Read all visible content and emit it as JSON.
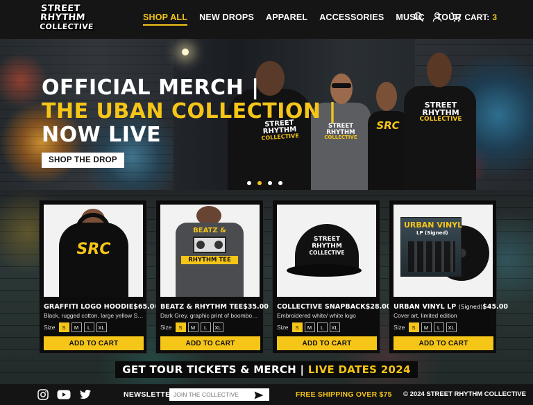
{
  "brand": {
    "logo_lines": [
      "STREET",
      "RHYTHM",
      "COLLECTIVE"
    ]
  },
  "nav": {
    "items": [
      {
        "label": "SHOP ALL",
        "active": true
      },
      {
        "label": "NEW DROPS"
      },
      {
        "label": "APPAREL"
      },
      {
        "label": "ACCESSORIES"
      },
      {
        "label": "MUSIC"
      },
      {
        "label": "TOUR"
      }
    ],
    "cart_label": "CART:",
    "cart_count": "3",
    "icons": [
      "search-icon",
      "user-icon",
      "cart-icon"
    ]
  },
  "hero": {
    "line1": "OFFICIAL MERCH |",
    "line2": "THE UBAN COLLECTION |",
    "line3": "NOW LIVE",
    "button": "SHOP THE DROP",
    "slide_count": 4,
    "active_slide": 2,
    "shirt_prints": [
      "STREET",
      "RHYTHM",
      "COLLECTIVE",
      "SRC"
    ]
  },
  "products": [
    {
      "name": "GRAFFITI LOGO HOODIE",
      "name_suffix": "",
      "price": "$65.00",
      "desc": "Black, rugged cotton, large yellow SRC",
      "image_text": "SRC"
    },
    {
      "name": "BEATZ & RHYTHM TEE",
      "name_suffix": "",
      "price": "$35.00",
      "desc": "Dark Grey, graphic print of boombox/...",
      "image_text_top": "BEATZ &",
      "image_text_bottom": "RHYTHM TEE"
    },
    {
      "name": "COLLECTIVE SNAPBACK",
      "name_suffix": "",
      "price": "$28.00",
      "desc": "Embroidered white/ white logo",
      "image_text": [
        "STREET",
        "RHYTHM",
        "COLLECTIVE"
      ]
    },
    {
      "name": "URBAN VINYL LP",
      "name_suffix": "(Signed)",
      "price": "$45.00",
      "desc": "Cover art, limited edition",
      "image_title": "URBAN VINYL",
      "image_sub": "LP (Signed)"
    }
  ],
  "sizes": {
    "label": "Size",
    "options": [
      "S",
      "M",
      "L",
      "XL"
    ],
    "selected": "S"
  },
  "add_to_cart": "ADD TO CART",
  "tour": {
    "text": "GET TOUR TICKETS & MERCH |",
    "highlight": "LIVE DATES 2024"
  },
  "footer": {
    "social": [
      "instagram-icon",
      "youtube-icon",
      "twitter-icon"
    ],
    "newsletter_label": "NEWSLETTER",
    "newsletter_placeholder": "JOIN THE COLLECTIVE",
    "shipping": "FREE SHIPPING OVER $75",
    "copyright": "© 2024 STREET RHYTHM COLLECTIVE"
  },
  "colors": {
    "accent": "#f5c518",
    "dark": "#151515"
  }
}
